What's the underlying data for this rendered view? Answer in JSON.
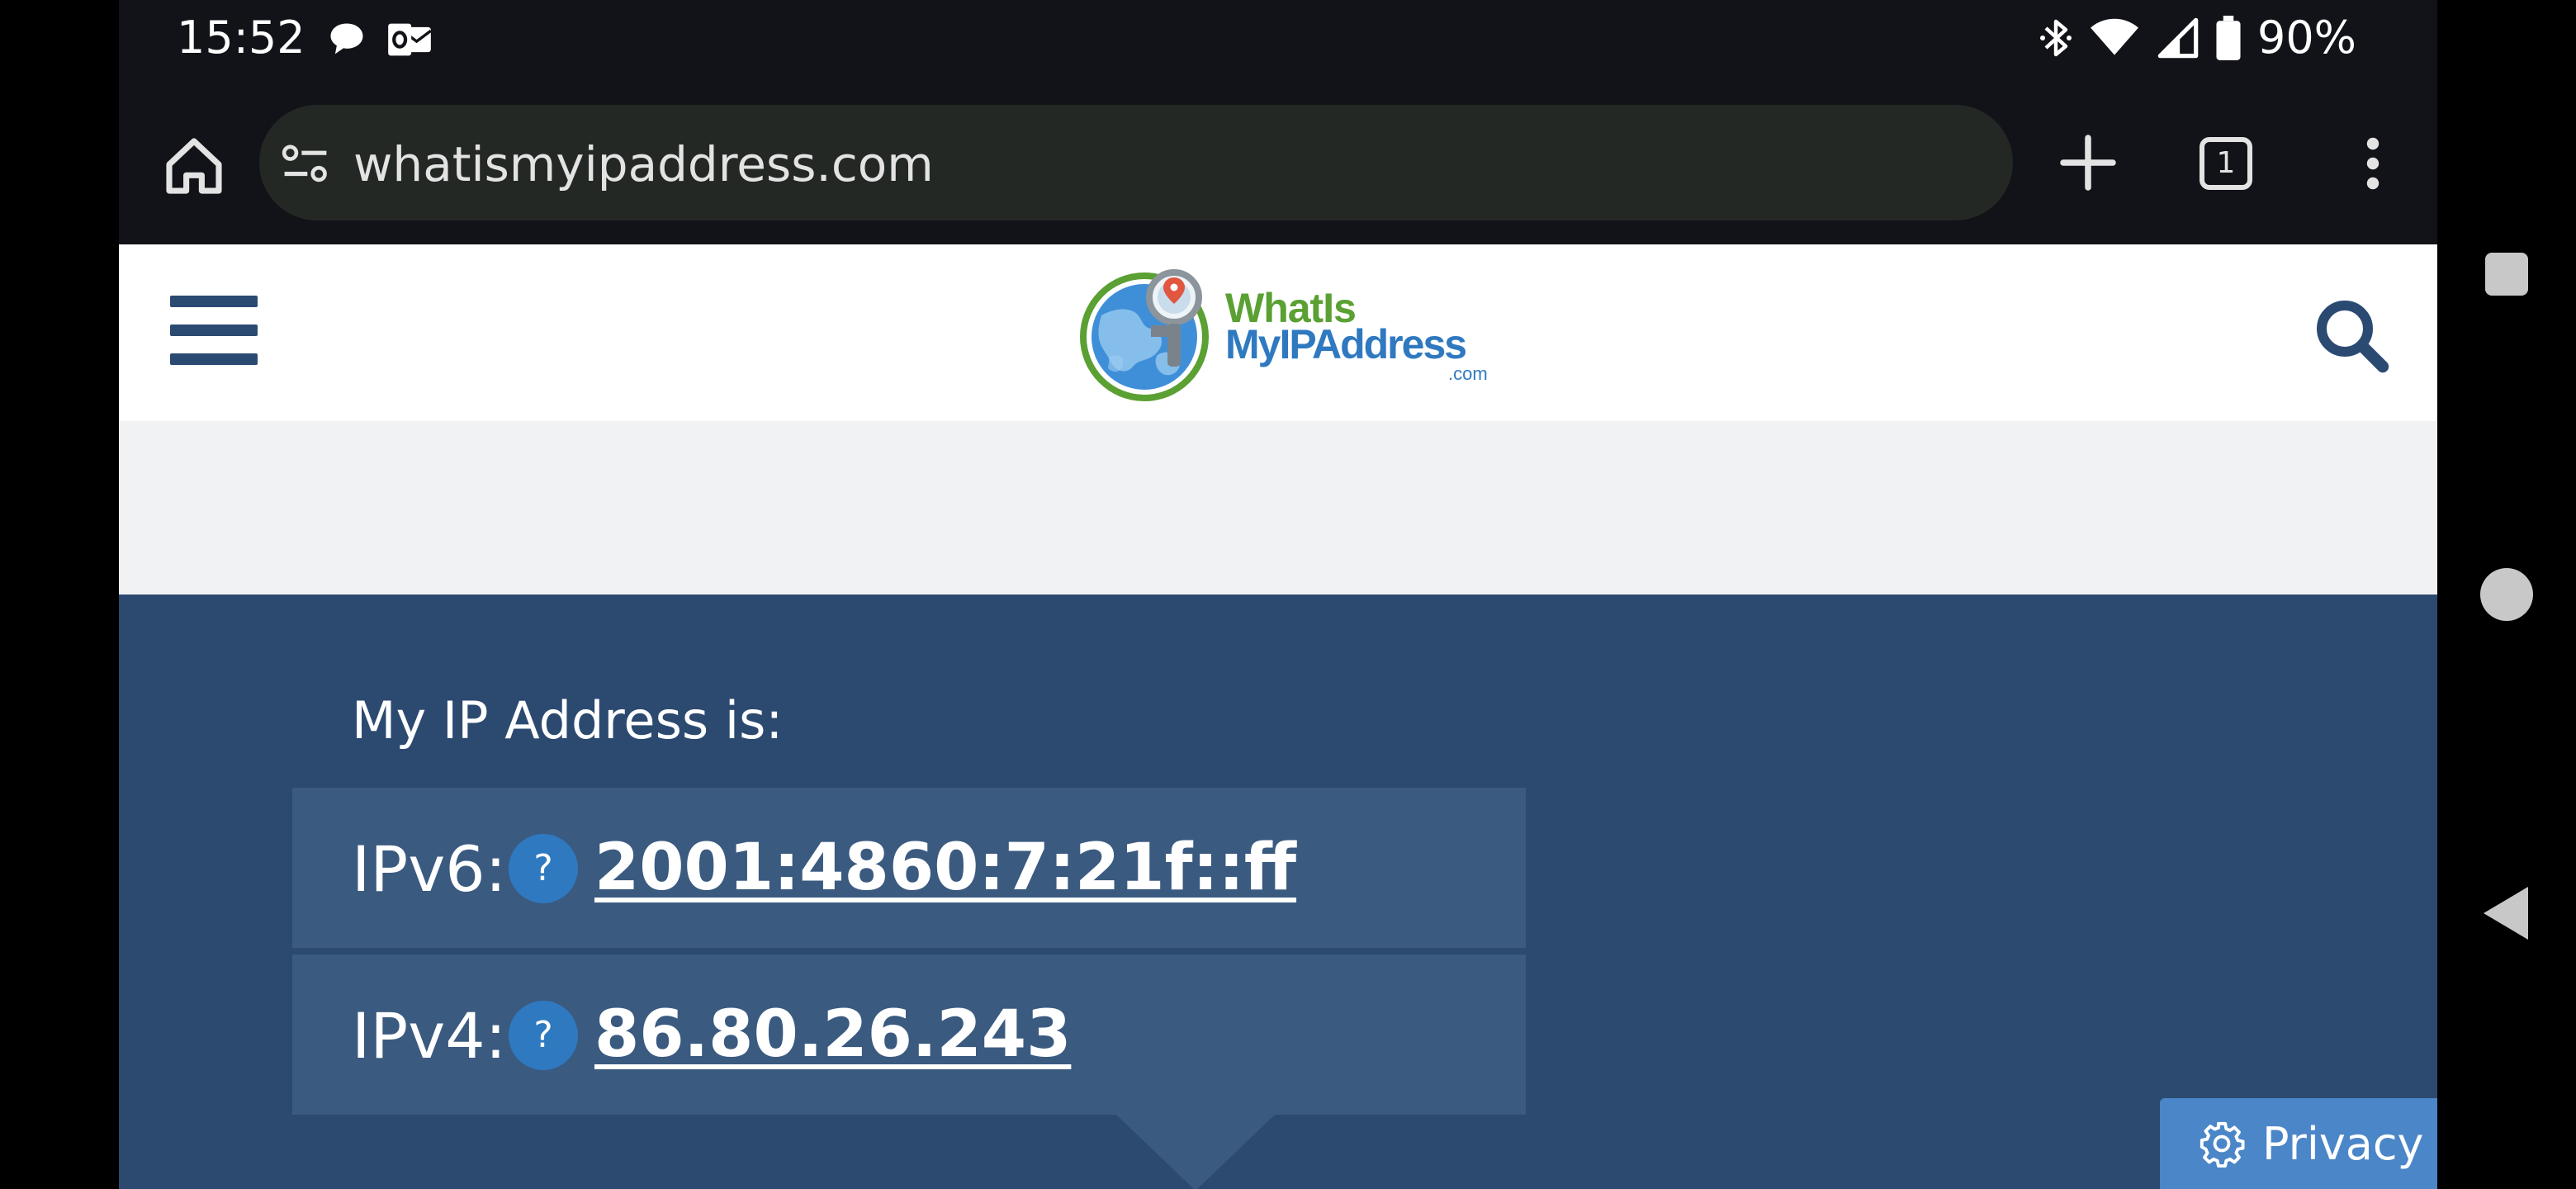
{
  "status_bar": {
    "time": "15:52",
    "left_icons": [
      "chat-bubble-icon",
      "outlook-icon"
    ],
    "right_icons": [
      "bluetooth-icon",
      "wifi-icon",
      "cell-signal-icon",
      "battery-icon"
    ],
    "battery": "90%"
  },
  "browser": {
    "url": "whatismyipaddress.com",
    "tab_count": "1",
    "icons": [
      "home-icon",
      "tune-icon",
      "plus-icon",
      "tab-switcher-icon",
      "more-vert-icon"
    ]
  },
  "site": {
    "logo": {
      "line1": "WhatIs",
      "line2": "MyIPAddress",
      "line3": ".com"
    },
    "colors": {
      "header_navy": "#2b4a72",
      "section_bg": "#2c4a70",
      "box_bg": "#3a5a80",
      "accent_blue": "#2f79c0",
      "logo_green": "#5aa032"
    }
  },
  "ip": {
    "heading": "My IP Address is:",
    "v6": {
      "label": "IPv6:",
      "help": "?",
      "value": "2001:4860:7:21f::ff"
    },
    "v4": {
      "label": "IPv4:",
      "help": "?",
      "value": "86.80.26.243"
    }
  },
  "privacy": {
    "label": "Privacy",
    "icon": "gear-icon"
  },
  "android_nav": [
    "recents-button",
    "home-button",
    "back-button"
  ]
}
